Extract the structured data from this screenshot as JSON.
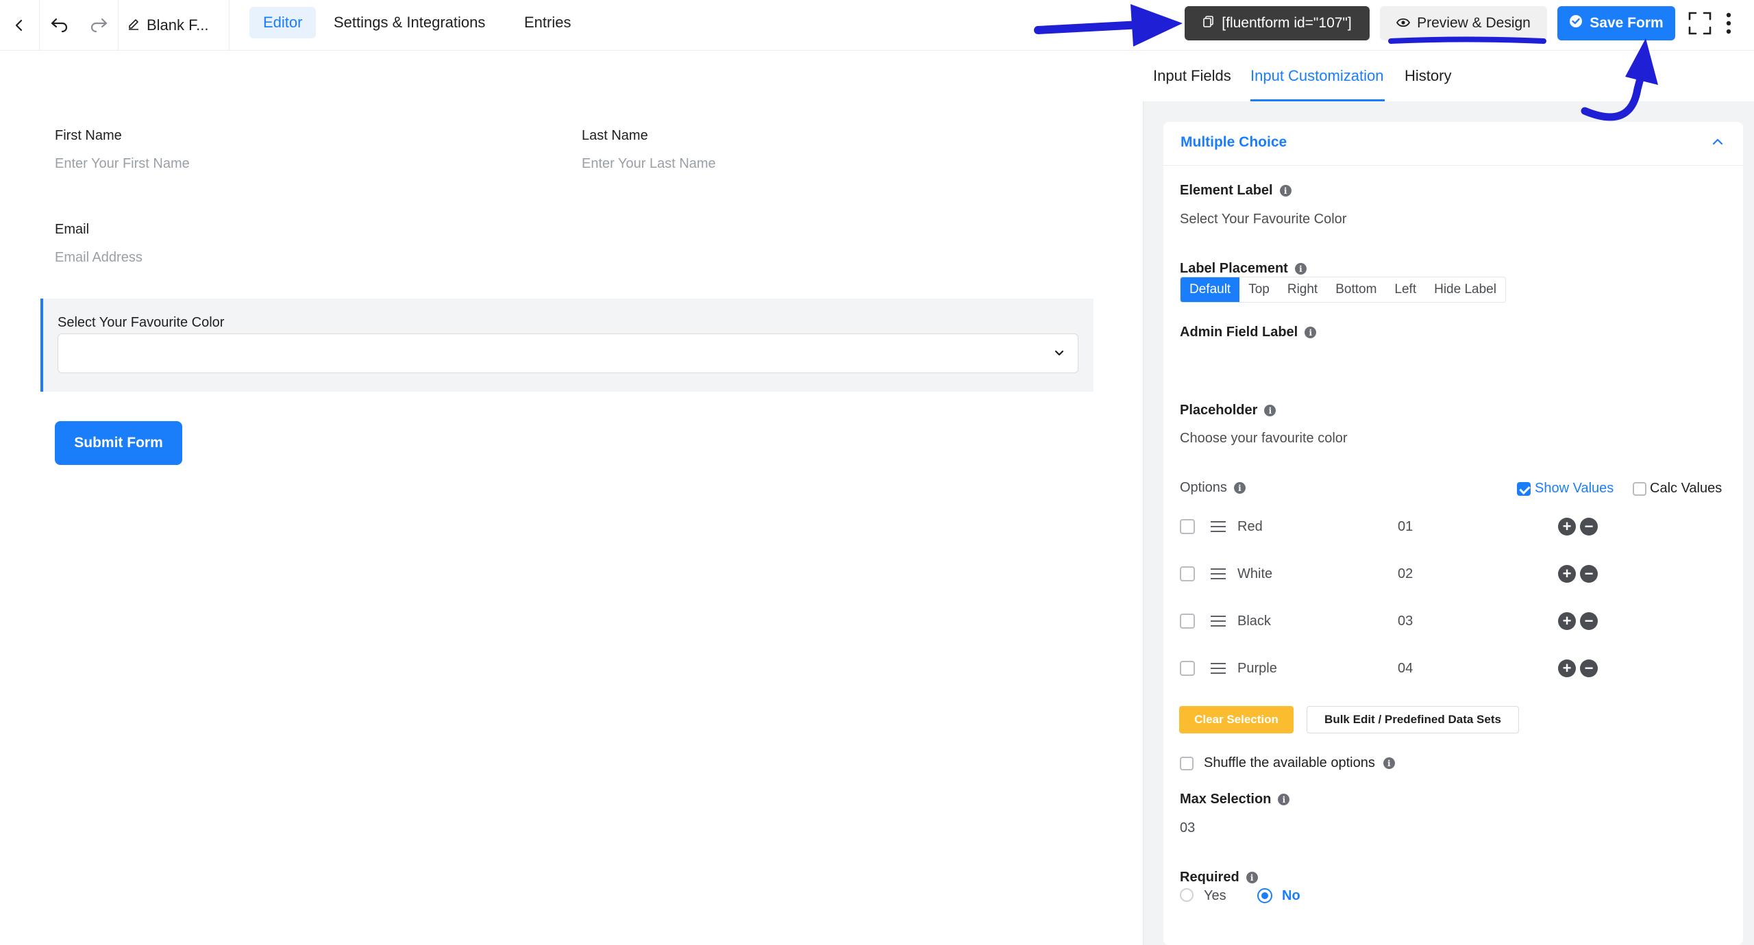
{
  "header": {
    "form_name": "Blank F...",
    "tabs": [
      "Editor",
      "Settings & Integrations",
      "Entries"
    ],
    "shortcode": "[fluentform id=\"107\"]",
    "preview_label": "Preview & Design",
    "save_label": "Save Form"
  },
  "form": {
    "first_name": {
      "label": "First Name",
      "placeholder": "Enter Your First Name"
    },
    "last_name": {
      "label": "Last Name",
      "placeholder": "Enter Your Last Name"
    },
    "email": {
      "label": "Email",
      "placeholder": "Email Address"
    },
    "color_select": {
      "label": "Select Your Favourite Color"
    },
    "submit_label": "Submit Form"
  },
  "panel": {
    "tabs": [
      "Input Fields",
      "Input Customization",
      "History"
    ],
    "section_title": "Multiple Choice",
    "element_label": {
      "label": "Element Label",
      "value": "Select Your Favourite Color"
    },
    "label_placement": {
      "label": "Label Placement",
      "options": [
        "Default",
        "Top",
        "Right",
        "Bottom",
        "Left",
        "Hide Label"
      ],
      "selected": "Default"
    },
    "admin_field_label": {
      "label": "Admin Field Label"
    },
    "placeholder": {
      "label": "Placeholder",
      "value": "Choose your favourite color"
    },
    "options": {
      "label": "Options",
      "show_values_label": "Show Values",
      "calc_values_label": "Calc Values",
      "show_values_checked": true,
      "calc_values_checked": false,
      "items": [
        {
          "label": "Red",
          "value": "01"
        },
        {
          "label": "White",
          "value": "02"
        },
        {
          "label": "Black",
          "value": "03"
        },
        {
          "label": "Purple",
          "value": "04"
        }
      ]
    },
    "clear_selection_label": "Clear Selection",
    "bulk_edit_label": "Bulk Edit / Predefined Data Sets",
    "shuffle_label": "Shuffle the available options",
    "max_selection": {
      "label": "Max Selection",
      "value": "03"
    },
    "required": {
      "label": "Required",
      "yes": "Yes",
      "no": "No",
      "selected": "No"
    }
  },
  "colors": {
    "accent": "#1a7efb",
    "warning": "#fbbc2f",
    "annotation": "#1f1fd6",
    "dark": "#3c3c3c"
  }
}
